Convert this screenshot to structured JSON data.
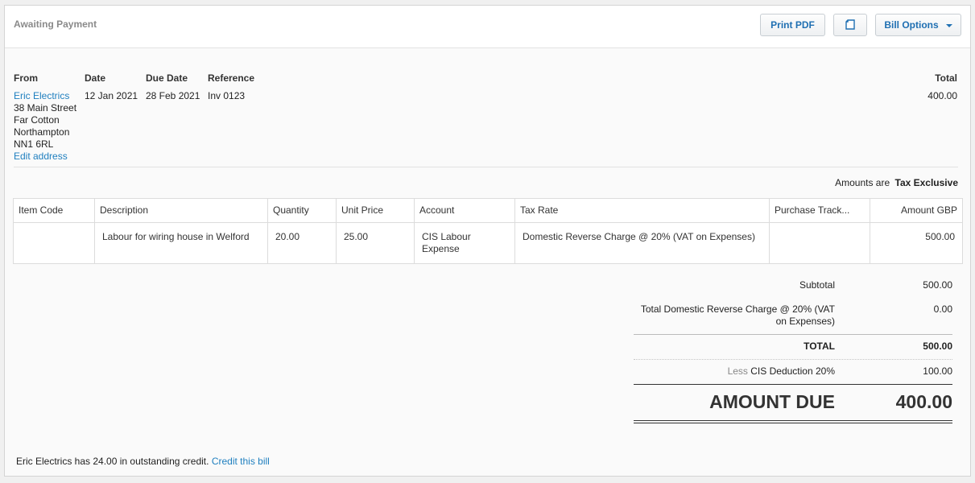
{
  "header": {
    "status": "Awaiting Payment",
    "print_pdf": "Print PDF",
    "bill_options": "Bill Options",
    "copy_icon": "copy-icon"
  },
  "bill": {
    "from_label": "From",
    "date_label": "Date",
    "due_date_label": "Due Date",
    "reference_label": "Reference",
    "total_label": "Total",
    "from_name": "Eric Electrics",
    "address": [
      "38 Main Street",
      "Far Cotton",
      "Northampton",
      "NN1 6RL"
    ],
    "edit_address": "Edit address",
    "date": "12 Jan 2021",
    "due_date": "28 Feb 2021",
    "reference": "Inv 0123",
    "total": "400.00"
  },
  "amounts": {
    "prefix": "Amounts are",
    "mode": "Tax Exclusive"
  },
  "table": {
    "columns": [
      "Item Code",
      "Description",
      "Quantity",
      "Unit Price",
      "Account",
      "Tax Rate",
      "Purchase Track...",
      "Amount GBP"
    ],
    "rows": [
      {
        "item_code": "",
        "description": "Labour for wiring house in Welford",
        "quantity": "20.00",
        "unit_price": "25.00",
        "account_line1": "CIS Labour",
        "account_line2": "Expense",
        "tax_rate": "Domestic Reverse Charge @ 20% (VAT on Expenses)",
        "tracking": "",
        "amount": "500.00"
      }
    ]
  },
  "totals": {
    "subtotal_label": "Subtotal",
    "subtotal": "500.00",
    "reverse_charge_label_1": "Total Domestic Reverse Charge @ 20% (VAT",
    "reverse_charge_label_2": "on Expenses)",
    "reverse_charge": "0.00",
    "total_label": "TOTAL",
    "total": "500.00",
    "less_label": "Less",
    "cis_label": "CIS Deduction 20%",
    "cis": "100.00",
    "amount_due_label": "AMOUNT DUE",
    "amount_due": "400.00"
  },
  "footer": {
    "credit_text": "Eric Electrics has 24.00 in outstanding credit.",
    "credit_link": "Credit this bill"
  }
}
